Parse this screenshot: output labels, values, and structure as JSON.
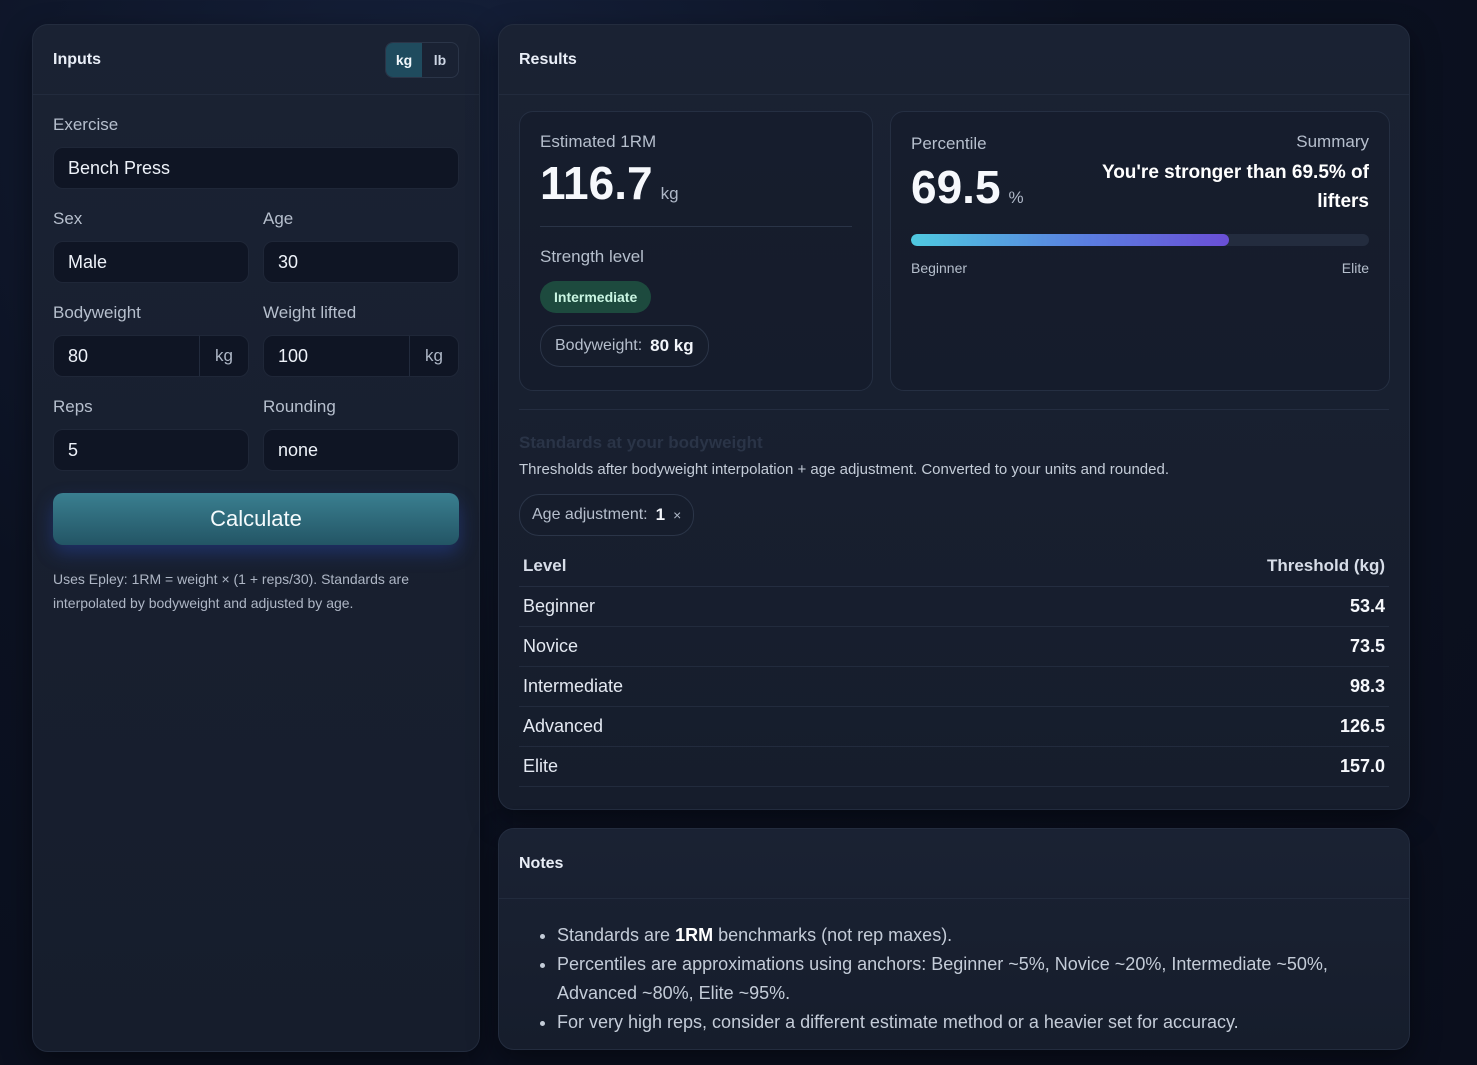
{
  "inputs": {
    "title": "Inputs",
    "units": [
      "kg",
      "lb"
    ],
    "active_unit": "kg",
    "exercise_label": "Exercise",
    "exercise_value": "Bench Press",
    "sex_label": "Sex",
    "sex_value": "Male",
    "age_label": "Age",
    "age_value": "30",
    "bodyweight_label": "Bodyweight",
    "bodyweight_value": "80",
    "bodyweight_unit": "kg",
    "weight_label": "Weight lifted",
    "weight_value": "100",
    "weight_unit": "kg",
    "reps_label": "Reps",
    "reps_value": "5",
    "rounding_label": "Rounding",
    "rounding_value": "none",
    "calculate_label": "Calculate",
    "help_text": "Uses Epley: 1RM = weight × (1 + reps/30). Standards are interpolated by bodyweight and adjusted by age."
  },
  "results": {
    "title": "Results",
    "e1rm_label": "Estimated 1RM",
    "e1rm_value": "116.7",
    "e1rm_unit": "kg",
    "strength_label": "Strength level",
    "strength_value": "Intermediate",
    "bw_label": "Bodyweight:",
    "bw_value": "80 kg",
    "percentile_label": "Percentile",
    "percentile_value": "69.5",
    "percentile_unit": "%",
    "percentile_fraction": 0.695,
    "summary_label": "Summary",
    "summary_text": "You're stronger than 69.5% of lifters",
    "bar_start": "Beginner",
    "bar_end": "Elite",
    "standards_title": "Standards at your bodyweight",
    "standards_sub": "Thresholds after bodyweight interpolation + age adjustment. Converted to your units and rounded.",
    "age_adj_label": "Age adjustment:",
    "age_adj_value": "1",
    "age_adj_suffix": "×",
    "table_headers": [
      "Level",
      "Threshold (kg)"
    ],
    "table_rows": [
      {
        "level": "Beginner",
        "threshold": "53.4"
      },
      {
        "level": "Novice",
        "threshold": "73.5"
      },
      {
        "level": "Intermediate",
        "threshold": "98.3"
      },
      {
        "level": "Advanced",
        "threshold": "126.5"
      },
      {
        "level": "Elite",
        "threshold": "157.0"
      }
    ]
  },
  "notes": {
    "title": "Notes",
    "items": [
      {
        "pre": "Standards are ",
        "bold": "1RM",
        "post": " benchmarks (not rep maxes)."
      },
      {
        "pre": "Percentiles are approximations using anchors: Beginner ~5%, Novice ~20%, Intermediate ~50%, Advanced ~80%, Elite ~95%.",
        "bold": "",
        "post": ""
      },
      {
        "pre": "For very high reps, consider a different estimate method or a heavier set for accuracy.",
        "bold": "",
        "post": ""
      }
    ]
  },
  "colors": {
    "accent": "#3a7f90",
    "badge_bg": "#1d4a3e",
    "bar_start": "#4fc9e0",
    "bar_end": "#6a4fd6"
  }
}
